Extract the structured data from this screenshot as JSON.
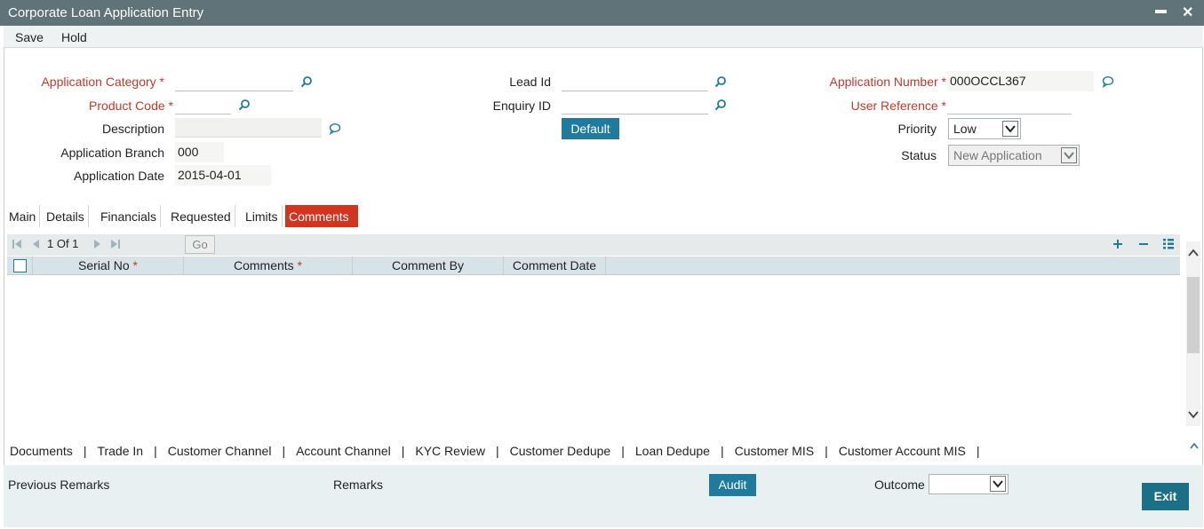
{
  "window": {
    "title": "Corporate Loan Application Entry",
    "minimize": "▬",
    "close": "✕"
  },
  "menu": {
    "save": "Save",
    "hold": "Hold"
  },
  "form": {
    "application_category": {
      "label": "Application Category",
      "value": ""
    },
    "product_code": {
      "label": "Product Code",
      "value": ""
    },
    "description": {
      "label": "Description",
      "value": ""
    },
    "application_branch": {
      "label": "Application Branch",
      "value": "000"
    },
    "application_date": {
      "label": "Application Date",
      "value": "2015-04-01"
    },
    "lead_id": {
      "label": "Lead Id",
      "value": ""
    },
    "enquiry_id": {
      "label": "Enquiry ID",
      "value": ""
    },
    "default_button": "Default",
    "application_number": {
      "label": "Application Number",
      "value": "000OCCL367"
    },
    "user_reference": {
      "label": "User Reference",
      "value": ""
    },
    "priority": {
      "label": "Priority",
      "value": "Low"
    },
    "status": {
      "label": "Status",
      "value": "New Application"
    },
    "required_mark": "*"
  },
  "tabs": [
    {
      "label": "Main"
    },
    {
      "label": "Details"
    },
    {
      "label": "Financials"
    },
    {
      "label": "Requested"
    },
    {
      "label": "Limits"
    },
    {
      "label": "Comments"
    }
  ],
  "grid": {
    "pagination": "1 Of 1",
    "go_button": "Go",
    "columns": [
      "Serial No",
      "Comments",
      "Comment By",
      "Comment Date"
    ],
    "required_columns": [
      true,
      true,
      false,
      false
    ],
    "rows": []
  },
  "links": [
    "Documents",
    "Trade In",
    "Customer Channel",
    "Account Channel",
    "KYC Review",
    "Customer Dedupe",
    "Loan Dedupe",
    "Customer MIS",
    "Customer Account MIS"
  ],
  "link_separator": "|",
  "footer": {
    "previous_remarks": "Previous Remarks",
    "remarks": "Remarks",
    "audit_button": "Audit",
    "outcome_label": "Outcome",
    "outcome_value": "",
    "exit_button": "Exit"
  },
  "colors": {
    "title_bar": "#5f7379",
    "accent": "#1f7a9e",
    "active_tab": "#d2351f",
    "required": "#c0392b"
  }
}
